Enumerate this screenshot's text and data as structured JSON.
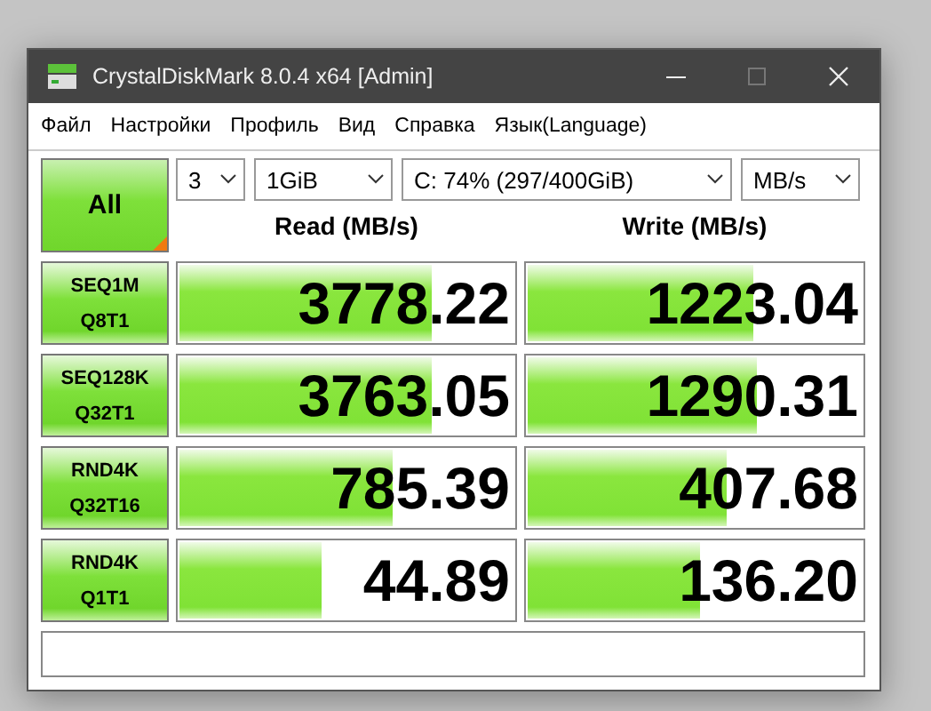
{
  "window": {
    "title": "CrystalDiskMark 8.0.4 x64 [Admin]"
  },
  "menu": [
    "Файл",
    "Настройки",
    "Профиль",
    "Вид",
    "Справка",
    "Язык(Language)"
  ],
  "all_button": "All",
  "selects": [
    {
      "value": "3"
    },
    {
      "value": "1GiB"
    },
    {
      "value": "C: 74% (297/400GiB)"
    },
    {
      "value": "MB/s"
    }
  ],
  "columns": [
    "Read (MB/s)",
    "Write (MB/s)"
  ],
  "tests": [
    {
      "line1": "SEQ1M",
      "line2": "Q8T1",
      "read": {
        "value": "3778.22",
        "level": 0.76
      },
      "write": {
        "value": "1223.04",
        "level": 0.68
      }
    },
    {
      "line1": "SEQ128K",
      "line2": "Q32T1",
      "read": {
        "value": "3763.05",
        "level": 0.76
      },
      "write": {
        "value": "1290.31",
        "level": 0.69
      }
    },
    {
      "line1": "RND4K",
      "line2": "Q32T16",
      "read": {
        "value": "785.39",
        "level": 0.64
      },
      "write": {
        "value": "407.68",
        "level": 0.6
      }
    },
    {
      "line1": "RND4K",
      "line2": "Q1T1",
      "read": {
        "value": "44.89",
        "level": 0.43
      },
      "write": {
        "value": "136.20",
        "level": 0.52
      }
    }
  ]
}
